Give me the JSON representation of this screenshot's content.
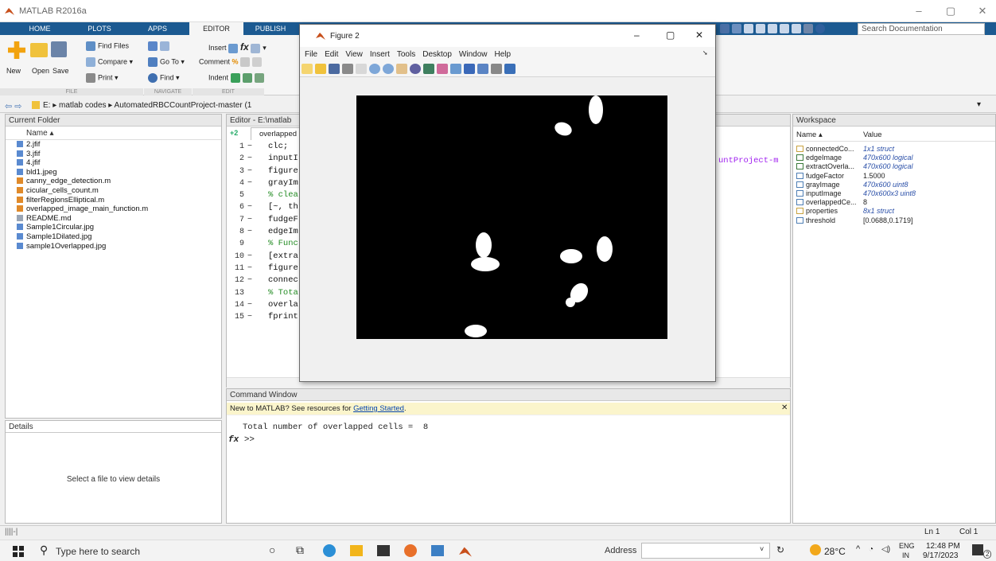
{
  "app": {
    "title": "MATLAB R2016a"
  },
  "main_tabs": [
    {
      "label": "HOME"
    },
    {
      "label": "PLOTS"
    },
    {
      "label": "APPS"
    },
    {
      "label": "EDITOR"
    },
    {
      "label": "PUBLISH"
    }
  ],
  "ribbon": {
    "new": "New",
    "open": "Open",
    "save": "Save",
    "find_files": "Find Files",
    "compare": "Compare ▾",
    "print": "Print ▾",
    "go_to": "Go To ▾",
    "find": "Find ▾",
    "insert": "Insert",
    "comment": "Comment",
    "indent": "Indent",
    "sections": {
      "file": "FILE",
      "navigate": "NAVIGATE",
      "edit": "EDIT"
    }
  },
  "search": {
    "placeholder": "Search Documentation"
  },
  "address": {
    "path": "E: ▸ matlab codes ▸ AutomatedRBCCountProject-master (1"
  },
  "current_folder": {
    "title": "Current Folder",
    "col_name": "Name ▴",
    "files": [
      {
        "name": "2.jfif",
        "type": "img"
      },
      {
        "name": "3.jfif",
        "type": "img"
      },
      {
        "name": "4.jfif",
        "type": "img"
      },
      {
        "name": "bld1.jpeg",
        "type": "img"
      },
      {
        "name": "canny_edge_detection.m",
        "type": "m"
      },
      {
        "name": "cicular_cells_count.m",
        "type": "m"
      },
      {
        "name": "filterRegionsElliptical.m",
        "type": "m"
      },
      {
        "name": "overlapped_image_main_function.m",
        "type": "m"
      },
      {
        "name": "README.md",
        "type": "md"
      },
      {
        "name": "Sample1Circular.jpg",
        "type": "img"
      },
      {
        "name": "Sample1Dilated.jpg",
        "type": "img"
      },
      {
        "name": "sample1Overlapped.jpg",
        "type": "img"
      }
    ]
  },
  "details": {
    "title": "Details",
    "message": "Select a file to view details"
  },
  "editor": {
    "title": "Editor - E:\\matlab",
    "tab": "overlapped",
    "tab_plus": "+2",
    "path_overflow": "untProject-m",
    "lines": [
      {
        "num": "1",
        "dash": "−",
        "text": "clc;",
        "comment": false
      },
      {
        "num": "2",
        "dash": "−",
        "text": "inputI",
        "comment": false
      },
      {
        "num": "3",
        "dash": "−",
        "text": "figure",
        "comment": false
      },
      {
        "num": "4",
        "dash": "−",
        "text": "grayIm",
        "comment": false
      },
      {
        "num": "5",
        "dash": " ",
        "text": "% clea",
        "comment": true
      },
      {
        "num": "6",
        "dash": "−",
        "text": "[~, th",
        "comment": false
      },
      {
        "num": "7",
        "dash": "−",
        "text": "fudgeF",
        "comment": false
      },
      {
        "num": "8",
        "dash": "−",
        "text": "edgeIm",
        "comment": false
      },
      {
        "num": "9",
        "dash": " ",
        "text": "% Func",
        "comment": true
      },
      {
        "num": "10",
        "dash": "−",
        "text": "[extra",
        "comment": false
      },
      {
        "num": "11",
        "dash": "−",
        "text": "figure",
        "comment": false
      },
      {
        "num": "12",
        "dash": "−",
        "text": "connec",
        "comment": false
      },
      {
        "num": "13",
        "dash": " ",
        "text": "% Tota",
        "comment": true
      },
      {
        "num": "14",
        "dash": "−",
        "text": "overla",
        "comment": false
      },
      {
        "num": "15",
        "dash": "−",
        "text": "fprint",
        "comment": false
      }
    ]
  },
  "command_window": {
    "title": "Command Window",
    "note_prefix": "New to MATLAB? See resources for ",
    "note_link": "Getting Started",
    "note_suffix": ".",
    "output": "Total number of overlapped cells =  8",
    "prompt": ">>"
  },
  "workspace": {
    "title": "Workspace",
    "col_name": "Name ▴",
    "col_value": "Value",
    "vars": [
      {
        "name": "connectedCo...",
        "value": "1x1 struct",
        "italic": true,
        "kind": "struct"
      },
      {
        "name": "edgeImage",
        "value": "470x600 logical",
        "italic": true,
        "kind": "logical"
      },
      {
        "name": "extractOverla...",
        "value": "470x600 logical",
        "italic": true,
        "kind": "logical"
      },
      {
        "name": "fudgeFactor",
        "value": "1.5000",
        "italic": false,
        "kind": "num"
      },
      {
        "name": "grayImage",
        "value": "470x600 uint8",
        "italic": true,
        "kind": "num"
      },
      {
        "name": "inputImage",
        "value": "470x600x3 uint8",
        "italic": true,
        "kind": "num"
      },
      {
        "name": "overlappedCe...",
        "value": "8",
        "italic": false,
        "kind": "num"
      },
      {
        "name": "properties",
        "value": "8x1 struct",
        "italic": true,
        "kind": "struct"
      },
      {
        "name": "threshold",
        "value": "[0.0688,0.1719]",
        "italic": false,
        "kind": "num"
      }
    ]
  },
  "status": {
    "ln": "Ln  1",
    "col": "Col  1"
  },
  "figure": {
    "title": "Figure 2",
    "menu": [
      "File",
      "Edit",
      "View",
      "Insert",
      "Tools",
      "Desktop",
      "Window",
      "Help"
    ]
  },
  "taskbar": {
    "search_placeholder": "Type here to search",
    "address_label": "Address",
    "weather": "28°C",
    "lang_top": "ENG",
    "lang_bottom": "IN",
    "time": "12:48 PM",
    "date": "9/17/2023",
    "notif_count": "2"
  },
  "colors": {
    "matlab_blue": "#1c5a91",
    "accent_orange": "#e57b1a",
    "link": "#0645ad",
    "comment_green": "#228b22"
  }
}
